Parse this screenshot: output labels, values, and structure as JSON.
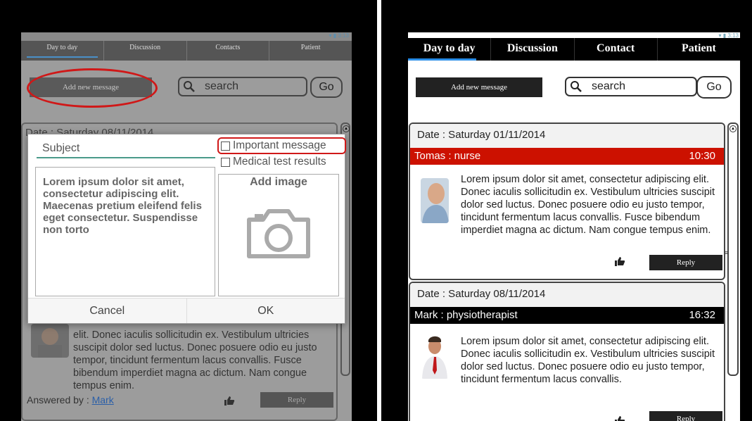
{
  "status_time": "3:13",
  "left": {
    "tabs": [
      "Day to day",
      "Discussion",
      "Contacts",
      "Patient"
    ],
    "add_button": "Add new message",
    "search": "search",
    "go": "Go",
    "bg_date": "Date : Saturday 08/11/2014",
    "bg_body": "elit. Donec iaculis sollicitudin ex. Vestibulum ultricies suscipit dolor sed luctus. Donec posuere odio eu justo tempor, tincidunt fermentum lacus convallis. Fusce bibendum imperdiet magna ac dictum. Nam congue tempus enim.",
    "answered_label": "Answered by :",
    "answered_name": "Mark",
    "reply": "Reply",
    "dialog": {
      "subject_placeholder": "Subject",
      "important": "Important message",
      "medical": "Medical test results",
      "body": "Lorem ipsum dolor sit amet, consectetur adipiscing elit. Maecenas pretium eleifend felis eget consectetur. Suspendisse non torto",
      "add_image": "Add image",
      "cancel": "Cancel",
      "ok": "OK"
    }
  },
  "right": {
    "tabs": [
      "Day to day",
      "Discussion",
      "Contact",
      "Patient"
    ],
    "add_button": "Add new message",
    "search": "search",
    "go": "Go",
    "messages": [
      {
        "date": "Date : Saturday 01/11/2014",
        "author": "Tomas : nurse",
        "time": "10:30",
        "bar_color": "#cc1100",
        "body": "Lorem ipsum dolor sit amet, consectetur adipiscing elit. Donec iaculis sollicitudin ex. Vestibulum ultricies suscipit dolor sed luctus. Donec posuere odio eu justo tempor, tincidunt fermentum lacus convallis. Fusce bibendum imperdiet magna ac dictum. Nam congue tempus enim.",
        "reply": "Reply"
      },
      {
        "date": "Date : Saturday 08/11/2014",
        "author": "Mark : physiotherapist",
        "time": "16:32",
        "bar_color": "#000000",
        "body": "Lorem ipsum dolor sit amet, consectetur adipiscing elit. Donec iaculis sollicitudin ex. Vestibulum ultricies suscipit dolor sed luctus. Donec posuere odio eu justo tempor, tincidunt fermentum lacus convallis.",
        "reply": "Reply"
      }
    ]
  },
  "colors": {
    "accent_blue": "#2a8ee8",
    "highlight_red": "#d01818",
    "dim_overlay": "#9c9c9c"
  },
  "icons": [
    "search-icon",
    "camera-icon",
    "thumbs-up-icon",
    "scroll-up-icon",
    "wifi-icon",
    "battery-icon"
  ]
}
